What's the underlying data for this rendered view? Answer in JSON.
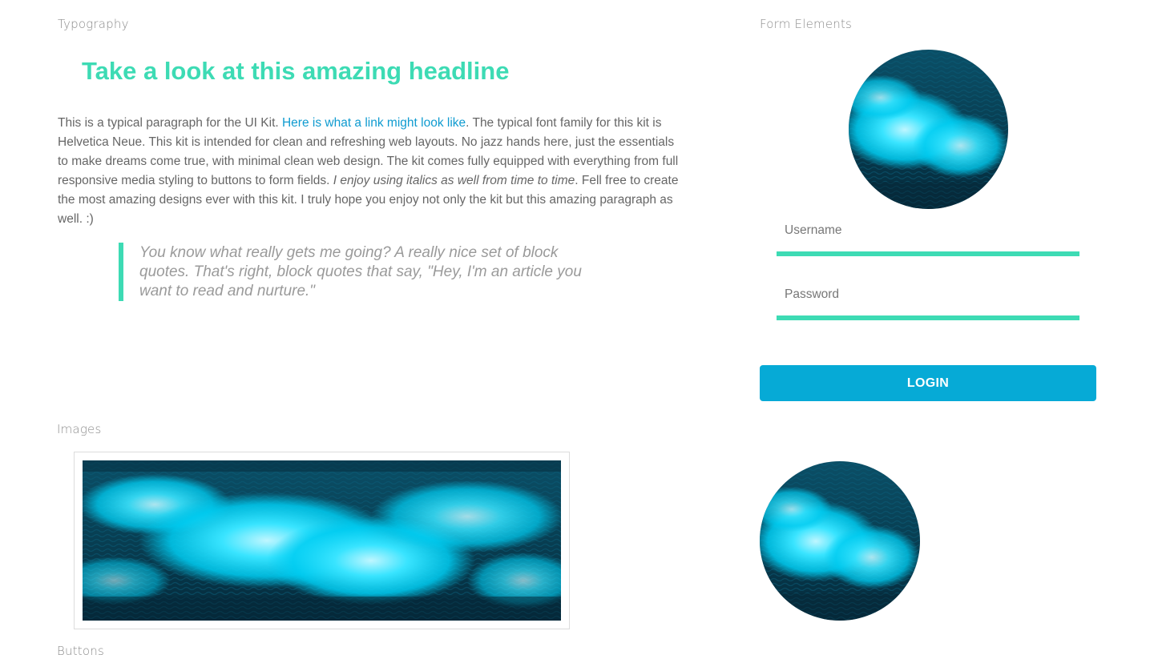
{
  "sections": {
    "typography": "Typography",
    "form_elements": "Form Elements",
    "images": "Images",
    "buttons": "Buttons"
  },
  "typography": {
    "headline": "Take a look at this amazing headline",
    "paragraph": {
      "text_1": "This is a typical paragraph for the UI Kit. ",
      "link": "Here is what a link might look like",
      "text_2": ". The typical font family for this kit is Helvetica Neue. This kit is intended for clean and refreshing web layouts. No jazz hands here, just the essentials to make dreams come true, with minimal clean web design. The kit comes fully equipped with everything from full responsive media styling to buttons to form fields. ",
      "italic": "I enjoy using italics as well from time to time",
      "text_3": ". Fell free to create the most amazing designs ever with this kit. I truly hope you enjoy not only the kit but this amazing paragraph as well. :)"
    },
    "blockquote": "You know what really gets me going? A really nice set of block quotes. That's right, block quotes that say, \"Hey, I'm an article you want to read and nurture.\""
  },
  "form": {
    "username_label": "Username",
    "username_value": "",
    "password_label": "Password",
    "password_value": "",
    "login_label": "LOGIN"
  },
  "colors": {
    "accent": "#3ddbb4",
    "link": "#0f9bd0",
    "button": "#06aad6",
    "water_light": "#00d8ff",
    "water_dark": "#062b3a"
  }
}
